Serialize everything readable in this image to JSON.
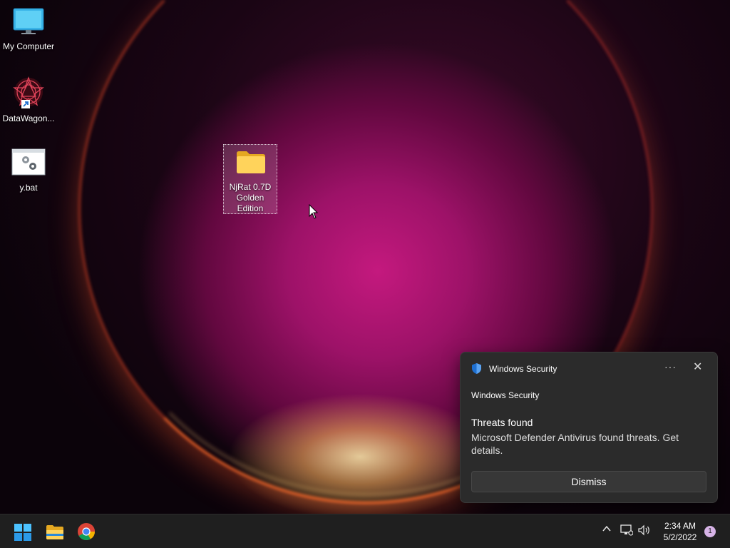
{
  "desktop": {
    "icons": [
      {
        "label": "My Computer",
        "icon": "monitor-icon"
      },
      {
        "label": "DataWagon...",
        "icon": "app-shortcut-icon"
      },
      {
        "label": "y.bat",
        "icon": "batch-file-icon"
      },
      {
        "label": "NjRat 0.7D Golden Edition",
        "icon": "folder-icon"
      }
    ]
  },
  "toast": {
    "app_name": "Windows Security",
    "more_label": "···",
    "close_label": "✕",
    "source": "Windows Security",
    "title": "Threats found",
    "body": "Microsoft Defender Antivirus found threats. Get details.",
    "dismiss_label": "Dismiss"
  },
  "taskbar": {
    "apps": [
      "start-icon",
      "file-explorer-icon",
      "chrome-icon"
    ],
    "tray": {
      "chevron_label": "^",
      "time": "2:34 AM",
      "date": "5/2/2022",
      "notification_count": "1"
    }
  },
  "colors": {
    "accent_blue": "#1e6fd0",
    "toast_bg": "#2b2b2b",
    "taskbar_bg": "#1f1f1f"
  }
}
